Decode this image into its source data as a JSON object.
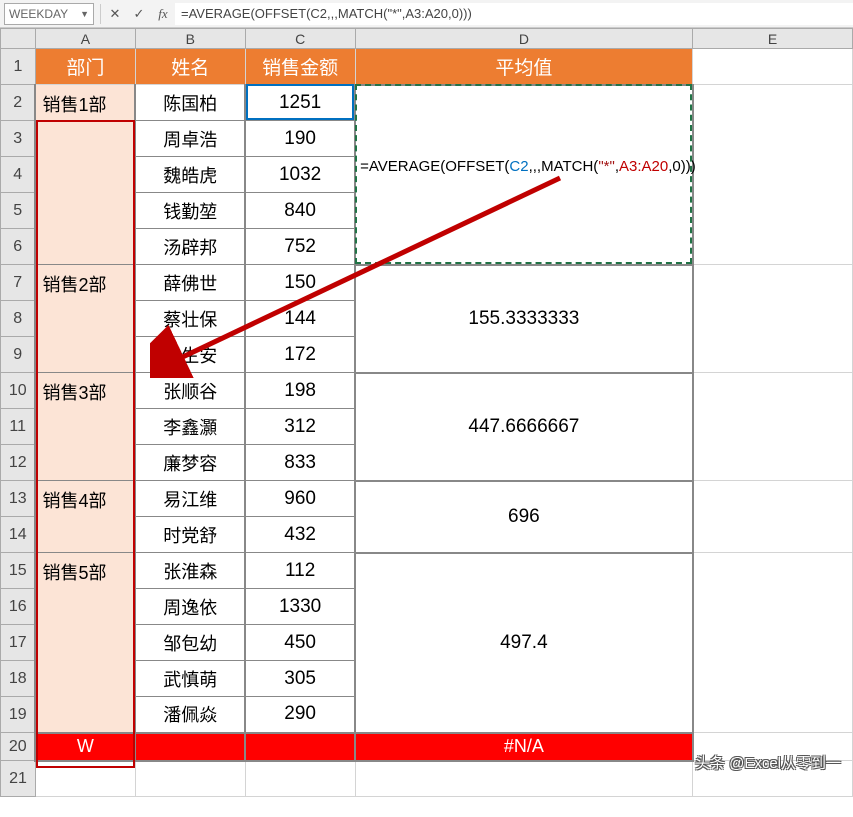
{
  "namebox": "WEEKDAY",
  "formula_bar": "=AVERAGE(OFFSET(C2,,,MATCH(\"*\",A3:A20,0)))",
  "columns": [
    "A",
    "B",
    "C",
    "D",
    "E"
  ],
  "row_labels": [
    "1",
    "2",
    "3",
    "4",
    "5",
    "6",
    "7",
    "8",
    "9",
    "10",
    "11",
    "12",
    "13",
    "14",
    "15",
    "16",
    "17",
    "18",
    "19",
    "20",
    "21"
  ],
  "headers": {
    "A": "部门",
    "B": "姓名",
    "C": "销售金额",
    "D": "平均值"
  },
  "formula_parts": {
    "p1": "=AVERAGE(OFFSET(",
    "p2": "C2",
    "p3": ",,,MATCH(",
    "p4": "\"*\"",
    "p5": ",",
    "p6": "A3:A20",
    "p7": ",0",
    "p8": ")))"
  },
  "dept": {
    "d1": "销售1部",
    "d2": "销售2部",
    "d3": "销售3部",
    "d4": "销售4部",
    "d5": "销售5部"
  },
  "rows": {
    "r2": {
      "name": "陈国柏",
      "amt": "1251"
    },
    "r3": {
      "name": "周卓浩",
      "amt": "190"
    },
    "r4": {
      "name": "魏皓虎",
      "amt": "1032"
    },
    "r5": {
      "name": "钱勤堃",
      "amt": "840"
    },
    "r6": {
      "name": "汤辟邦",
      "amt": "752"
    },
    "r7": {
      "name": "薛佛世",
      "amt": "150"
    },
    "r8": {
      "name": "蔡壮保",
      "amt": "144"
    },
    "r9": {
      "name": "王生安",
      "amt": "172"
    },
    "r10": {
      "name": "张顺谷",
      "amt": "198"
    },
    "r11": {
      "name": "李鑫灝",
      "amt": "312"
    },
    "r12": {
      "name": "廉梦容",
      "amt": "833"
    },
    "r13": {
      "name": "易江维",
      "amt": "960"
    },
    "r14": {
      "name": "时党舒",
      "amt": "432"
    },
    "r15": {
      "name": "张淮森",
      "amt": "112"
    },
    "r16": {
      "name": "周逸依",
      "amt": "1330"
    },
    "r17": {
      "name": "邹包幼",
      "amt": "450"
    },
    "r18": {
      "name": "武慎萌",
      "amt": "305"
    },
    "r19": {
      "name": "潘佩焱",
      "amt": "290"
    }
  },
  "avg": {
    "d2": "155.3333333",
    "d3": "447.6666667",
    "d4": "696",
    "d5": "497.4"
  },
  "row20": {
    "A": "W",
    "D": "#N/A"
  },
  "watermark": "头条 @Excel从零到一"
}
